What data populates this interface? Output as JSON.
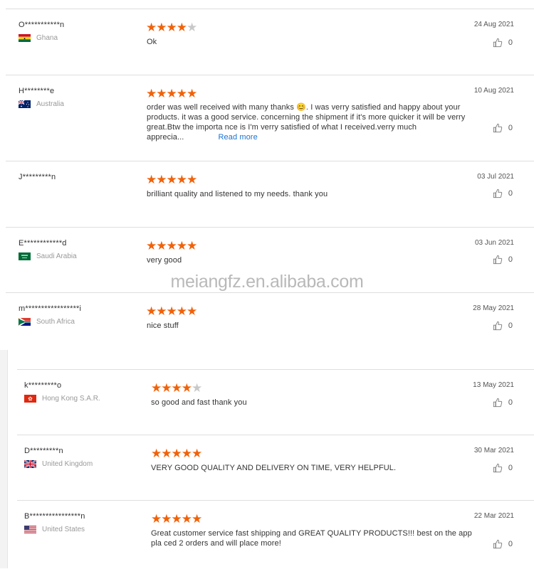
{
  "watermark": "meiangfz.en.alibaba.com",
  "reviews": [
    {
      "user": "O***********n",
      "country": "Ghana",
      "flag": "ghana",
      "stars": 4,
      "date": "24 Aug 2021",
      "text": "Ok",
      "likes": "0"
    },
    {
      "user": "H********e",
      "country": "Australia",
      "flag": "australia",
      "stars": 5,
      "date": "10 Aug 2021",
      "text": "order was well received with many thanks 😊.  I was verry satisfied and happy about your products. it was a good service. concerning the shipment if it's more quicker it will be verry great.Btw the importa nce is I'm verry satisfied of what I received.verry much apprecia...",
      "read_more": "Read more",
      "likes": "0"
    },
    {
      "user": "J*********n",
      "country": "",
      "flag": "",
      "stars": 5,
      "date": "03 Jul 2021",
      "text": "brilliant quality and listened to my needs. thank you",
      "likes": "0"
    },
    {
      "user": "E************d",
      "country": "Saudi Arabia",
      "flag": "saudi",
      "stars": 5,
      "date": "03 Jun 2021",
      "text": "very good",
      "likes": "0"
    },
    {
      "user": "m*****************i",
      "country": "South Africa",
      "flag": "southafrica",
      "stars": 5,
      "date": "28 May 2021",
      "text": "nice stuff",
      "likes": "0"
    },
    {
      "user": "k*********o",
      "country": "Hong Kong S.A.R.",
      "flag": "hongkong",
      "stars": 4,
      "date": "13 May 2021",
      "text": "so good and fast thank you",
      "likes": "0"
    },
    {
      "user": "D*********n",
      "country": "United Kingdom",
      "flag": "uk",
      "stars": 5,
      "date": "30 Mar 2021",
      "text": "VERY GOOD QUALITY AND DELIVERY ON TIME, VERY HELPFUL.",
      "likes": "0"
    },
    {
      "user": "B****************n",
      "country": "United States",
      "flag": "usa",
      "stars": 5,
      "date": "22 Mar 2021",
      "text": "Great customer service fast shipping and GREAT QUALITY PRODUCTS!!! best on the app pla ced 2 orders and will place more!",
      "likes": "0"
    }
  ]
}
